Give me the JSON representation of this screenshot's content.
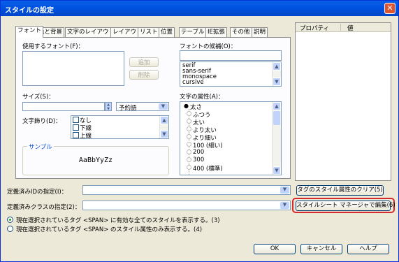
{
  "window": {
    "title": "スタイルの設定",
    "close_icon": "close-icon"
  },
  "tabs": [
    "フォント",
    "色と背景",
    "文字のレイアウト",
    "レイアウト",
    "リスト",
    "位置",
    "テーブル",
    "IE拡張",
    "その他",
    "説明"
  ],
  "font": {
    "used_fonts_label": "使用するフォント(F)：",
    "add_button": "追加",
    "remove_button": "削除",
    "candidates_label": "フォントの候補(O)：",
    "candidates": [
      "serif",
      "sans-serif",
      "monospace",
      "cursive"
    ],
    "size_label": "サイズ(S)：",
    "size_value": "",
    "size_preset": "予約語",
    "decoration_label": "文字飾り(D)：",
    "decorations": [
      "なし",
      "下線",
      "上線"
    ],
    "sample_label": "サンプル",
    "sample_text": "AaBbYyZz",
    "attr_label": "文字の属性(A)：",
    "attr_items": [
      "太さ",
      "ふつう",
      "太い",
      "より太い",
      "より細い",
      "100 (細い)",
      "200",
      "300",
      "400 (標準)"
    ]
  },
  "props": {
    "col_property": "プロパティ",
    "col_value": "値"
  },
  "defined_id_label": "定義済みIDの指定(I)：",
  "defined_id_value": "",
  "clear_button": "タグのスタイル属性のクリア(5)",
  "defined_class_label": "定義済みクラスの指定(2)：",
  "defined_class_value": "",
  "stylesheet_button": "スタイルシート マネージャで編集(6)",
  "highlight_color": "#d62a2a",
  "radio_all": "現在選択されているタグ <SPAN> に有効な全てのスタイルを表示する。(3)",
  "radio_style": "現在選択されているタグ <SPAN> のスタイル属性のみ表示する。(4)",
  "ok_button": "OK",
  "cancel_button": "キャンセル",
  "help_button": "ヘルプ"
}
